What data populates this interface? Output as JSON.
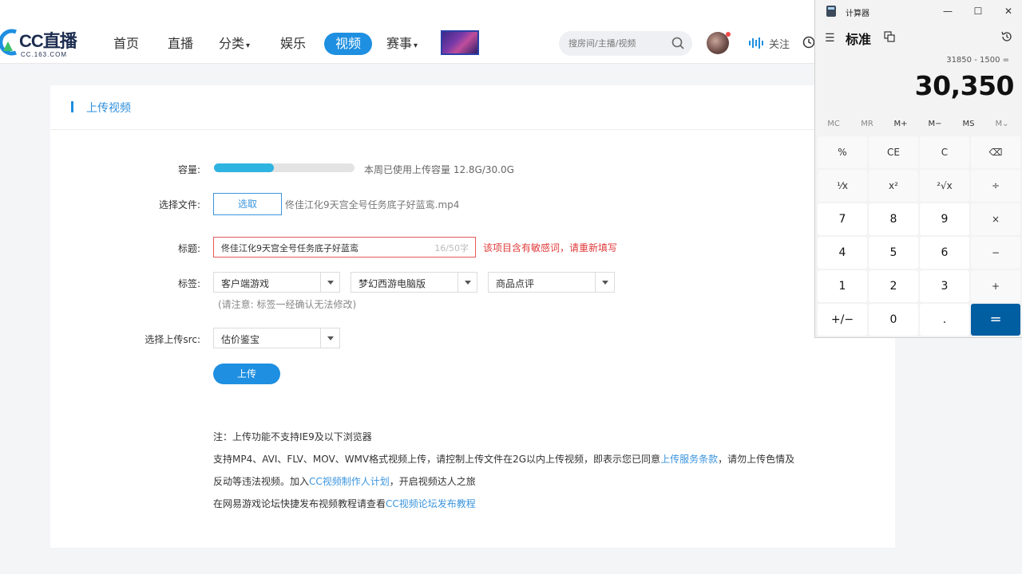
{
  "nav": {
    "logo_text": "CC直播",
    "logo_sub": "CC.163.COM",
    "items": [
      "首页",
      "直播",
      "分类",
      "娱乐",
      "视频",
      "赛事"
    ],
    "search_placeholder": "搜房间/主播/视频",
    "follow": "关注"
  },
  "card": {
    "title": "上传视频",
    "capacity_label": "容量:",
    "capacity_note": "本周已使用上传容量 12.8G/30.0G",
    "capacity_used_fraction": 0.427,
    "file_label": "选择文件:",
    "file_button": "选取",
    "file_name": "佟佳江化9天宫全号任务底子好蓝鸾.mp4",
    "title_label": "标题:",
    "title_value": "佟佳江化9天宫全号任务底子好蓝鸾",
    "title_count": "16/50字",
    "title_error": "该项目含有敏感词，请重新填写",
    "tags_label": "标签:",
    "tags": [
      "客户端游戏",
      "梦幻西游电脑版",
      "商品点评"
    ],
    "tags_note": "(请注意: 标签一经确认无法修改)",
    "src_label": "选择上传src:",
    "src_value": "估价鉴宝",
    "upload_button": "上传",
    "note1": "注：上传功能不支持IE9及以下浏览器",
    "note2a": "支持MP4、AVI、FLV、MOV、WMV格式视频上传，请控制上传文件在2G以内上传视频，即表示您已同意",
    "note2_link": "上传服务条款",
    "note2b": "，请勿上传色情及",
    "note3a": "反动等违法视频。加入",
    "note3_link": "CC视频制作人计划",
    "note3b": "，开启视频达人之旅",
    "note4a": "在网易游戏论坛快捷发布视频教程请查看",
    "note4_link": "CC视频论坛发布教程"
  },
  "calculator": {
    "title": "计算器",
    "mode": "标准",
    "expression": "31850 - 1500 =",
    "result": "30,350",
    "memory": [
      "MC",
      "MR",
      "M+",
      "M−",
      "MS",
      "M⌄"
    ],
    "keys": [
      [
        "%",
        "CE",
        "C",
        "⌫"
      ],
      [
        "¹⁄x",
        "x²",
        "²√x",
        "÷"
      ],
      [
        "7",
        "8",
        "9",
        "×"
      ],
      [
        "4",
        "5",
        "6",
        "−"
      ],
      [
        "1",
        "2",
        "3",
        "+"
      ],
      [
        "+/−",
        "0",
        ".",
        "="
      ]
    ]
  }
}
